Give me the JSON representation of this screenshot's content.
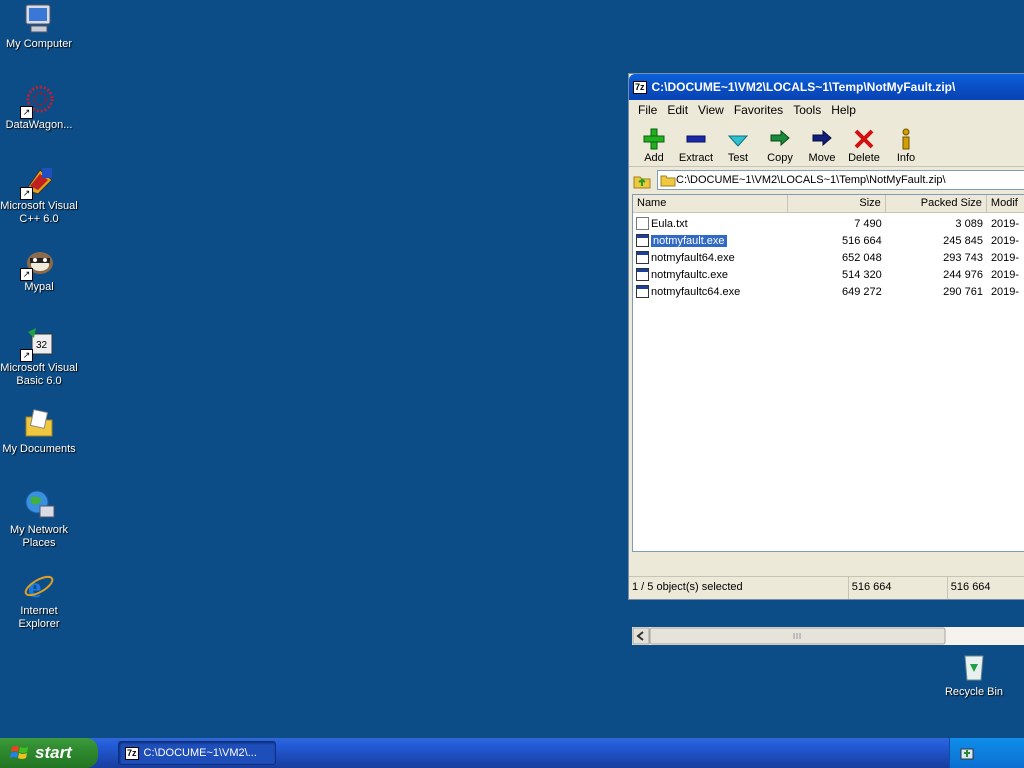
{
  "desktop": {
    "icons": [
      {
        "label": "My Computer",
        "icon": "my-computer-icon"
      },
      {
        "label": "DataWagon...",
        "icon": "datawagon-icon"
      },
      {
        "label": "Microsoft Visual C++ 6.0",
        "icon": "visual-cpp-icon"
      },
      {
        "label": "Mypal",
        "icon": "mypal-icon"
      },
      {
        "label": "Microsoft Visual Basic 6.0",
        "icon": "visual-basic-icon"
      },
      {
        "label": "My Documents",
        "icon": "my-documents-icon"
      },
      {
        "label": "My Network Places",
        "icon": "network-places-icon"
      },
      {
        "label": "Internet Explorer",
        "icon": "internet-explorer-icon"
      },
      {
        "label": "Recycle Bin",
        "icon": "recycle-bin-icon"
      }
    ]
  },
  "window": {
    "app_badge": "7z",
    "title": "C:\\DOCUME~1\\VM2\\LOCALS~1\\Temp\\NotMyFault.zip\\",
    "menu": [
      "File",
      "Edit",
      "View",
      "Favorites",
      "Tools",
      "Help"
    ],
    "toolbar": [
      {
        "label": "Add",
        "icon": "add-plus-icon",
        "color": "#20b020"
      },
      {
        "label": "Extract",
        "icon": "extract-minus-icon",
        "color": "#1a2aa8"
      },
      {
        "label": "Test",
        "icon": "test-check-icon",
        "color": "#20a0b0"
      },
      {
        "label": "Copy",
        "icon": "copy-arrows-icon",
        "color": "#1b8a3a"
      },
      {
        "label": "Move",
        "icon": "move-arrow-icon",
        "color": "#10207a"
      },
      {
        "label": "Delete",
        "icon": "delete-x-icon",
        "color": "#d01010"
      },
      {
        "label": "Info",
        "icon": "info-icon",
        "color": "#d0a000"
      }
    ],
    "address": "C:\\DOCUME~1\\VM2\\LOCALS~1\\Temp\\NotMyFault.zip\\",
    "columns": [
      "Name",
      "Size",
      "Packed Size",
      "Modif"
    ],
    "files": [
      {
        "name": "Eula.txt",
        "size": "7 490",
        "packed": "3 089",
        "modified": "2019-",
        "type": "txt",
        "selected": false
      },
      {
        "name": "notmyfault.exe",
        "size": "516 664",
        "packed": "245 845",
        "modified": "2019-",
        "type": "exe",
        "selected": true
      },
      {
        "name": "notmyfault64.exe",
        "size": "652 048",
        "packed": "293 743",
        "modified": "2019-",
        "type": "exe",
        "selected": false
      },
      {
        "name": "notmyfaultc.exe",
        "size": "514 320",
        "packed": "244 976",
        "modified": "2019-",
        "type": "exe",
        "selected": false
      },
      {
        "name": "notmyfaultc64.exe",
        "size": "649 272",
        "packed": "290 761",
        "modified": "2019-",
        "type": "exe",
        "selected": false
      }
    ],
    "status": {
      "selection": "1 / 5 object(s) selected",
      "size": "516 664",
      "packed": "516 664"
    }
  },
  "taskbar": {
    "start_label": "start",
    "task_badge": "7z",
    "task_label": "C:\\DOCUME~1\\VM2\\..."
  }
}
